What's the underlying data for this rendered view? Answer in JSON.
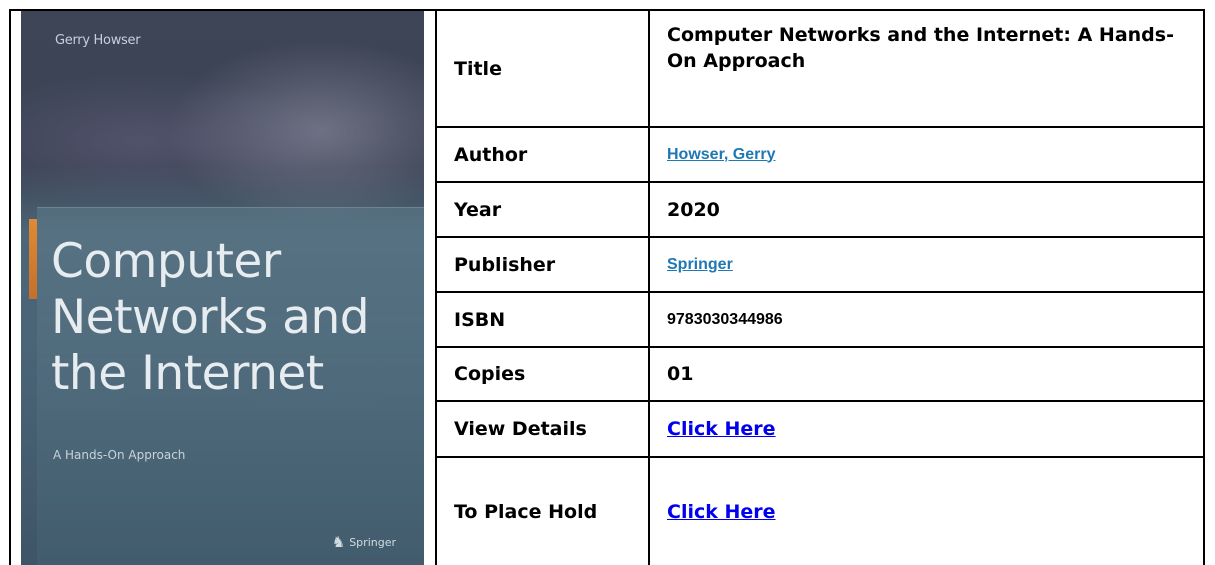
{
  "cover": {
    "author": "Gerry Howser",
    "title_lines": [
      "Computer",
      "Networks and",
      "the Internet"
    ],
    "subtitle": "A Hands-On Approach",
    "publisher": "Springer"
  },
  "rows": [
    {
      "label": "Title",
      "value": "Computer Networks and the Internet: A Hands-On Approach"
    },
    {
      "label": "Author",
      "value": "Howser, Gerry"
    },
    {
      "label": "Year",
      "value": "2020"
    },
    {
      "label": "Publisher",
      "value": "Springer"
    },
    {
      "label": "ISBN",
      "value": "9783030344986"
    },
    {
      "label": "Copies",
      "value": "01"
    },
    {
      "label": "View Details",
      "value": "Click Here"
    },
    {
      "label": "To Place Hold",
      "value": "Click Here"
    }
  ],
  "colors": {
    "border": "#000000",
    "author_link": "#1f77b4",
    "click_link": "#0000ee"
  }
}
